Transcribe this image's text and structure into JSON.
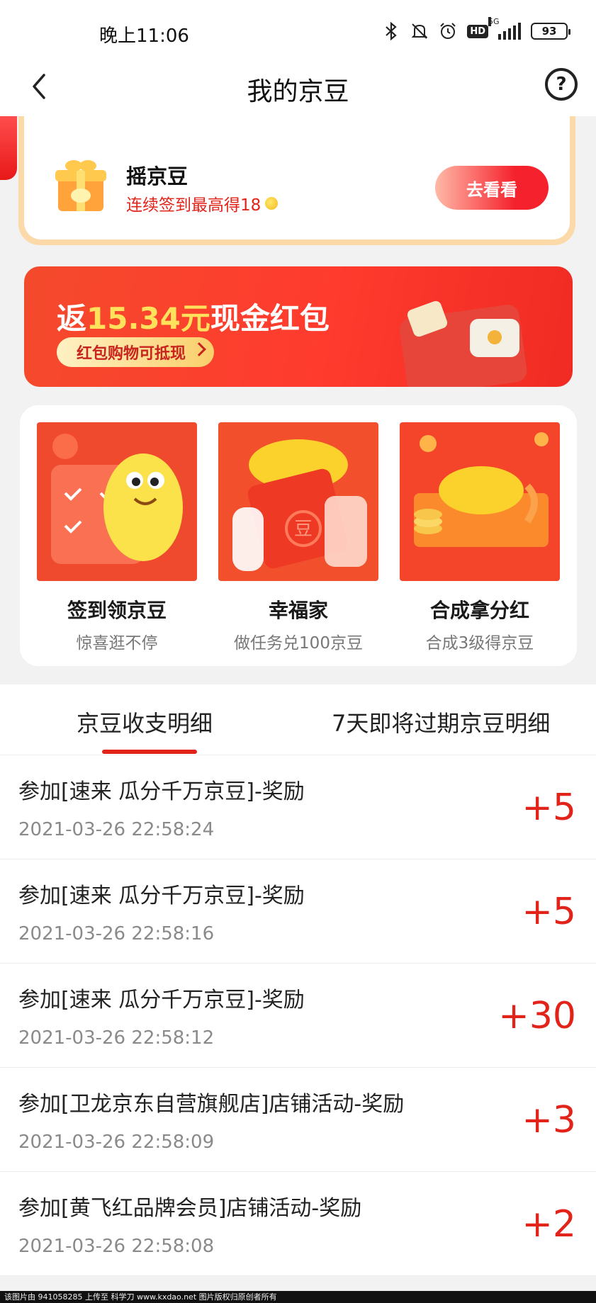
{
  "status_bar": {
    "time": "晚上11:06",
    "network": "5G",
    "battery": "93"
  },
  "header": {
    "title": "我的京豆"
  },
  "shake": {
    "title": "摇京豆",
    "subtitle": "连续签到最高得18",
    "button": "去看看"
  },
  "banner": {
    "prefix": "返",
    "amount": "15.34元",
    "suffix": "现金红包",
    "pill": "红包购物可抵现"
  },
  "activities": [
    {
      "name": "签到领京豆",
      "desc": "惊喜逛不停"
    },
    {
      "name": "幸福家",
      "desc": "做任务兑100京豆",
      "badge": "豆"
    },
    {
      "name": "合成拿分红",
      "desc": "合成3级得京豆"
    }
  ],
  "tabs": [
    {
      "label": "京豆收支明细"
    },
    {
      "label": "7天即将过期京豆明细"
    }
  ],
  "records": [
    {
      "desc": "参加[速来 瓜分千万京豆]-奖励",
      "date": "2021-03-26 22:58:24",
      "amount": "+5"
    },
    {
      "desc": "参加[速来 瓜分千万京豆]-奖励",
      "date": "2021-03-26 22:58:16",
      "amount": "+5"
    },
    {
      "desc": "参加[速来 瓜分千万京豆]-奖励",
      "date": "2021-03-26 22:58:12",
      "amount": "+30"
    },
    {
      "desc": "参加[卫龙京东自营旗舰店]店铺活动-奖励",
      "date": "2021-03-26 22:58:09",
      "amount": "+3"
    },
    {
      "desc": "参加[黄飞红品牌会员]店铺活动-奖励",
      "date": "2021-03-26 22:58:08",
      "amount": "+2"
    }
  ],
  "footer": "该图片由 941058285 上传至 科学刀 www.kxdao.net 图片版权归原创者所有",
  "colors": {
    "accent": "#e2231a",
    "gold": "#ffe15b"
  }
}
